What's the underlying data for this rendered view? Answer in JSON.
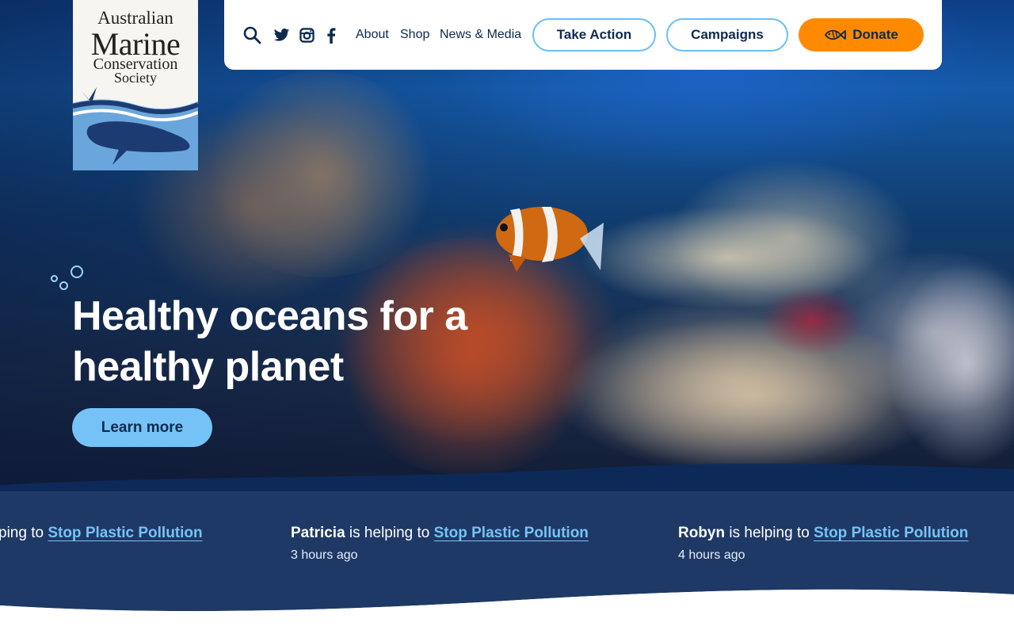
{
  "logo": {
    "line1": "Australian",
    "line2": "Marine",
    "line3": "Conservation",
    "line4": "Society"
  },
  "nav": {
    "icons": [
      "search-icon",
      "twitter-icon",
      "instagram-icon",
      "facebook-icon"
    ],
    "links": [
      "About",
      "Shop",
      "News & Media"
    ],
    "take_action": "Take Action",
    "campaigns": "Campaigns",
    "donate": "Donate"
  },
  "hero": {
    "headline_line1": "Healthy oceans for a",
    "headline_line2": "healthy planet",
    "cta": "Learn more"
  },
  "ticker": [
    {
      "name": "",
      "mid": "ping to ",
      "cause": "Stop Plastic Pollution",
      "time": ""
    },
    {
      "name": "Patricia",
      "mid": " is helping to ",
      "cause": "Stop Plastic Pollution",
      "time": "3 hours ago"
    },
    {
      "name": "Robyn",
      "mid": " is helping to ",
      "cause": "Stop Plastic Pollution",
      "time": "4 hours ago"
    }
  ],
  "colors": {
    "navy": "#0e2a4f",
    "sky": "#75c3f6",
    "outline": "#6cc0f0",
    "donate": "#ff8a00",
    "ticker_bg": "#0d2a5a"
  }
}
